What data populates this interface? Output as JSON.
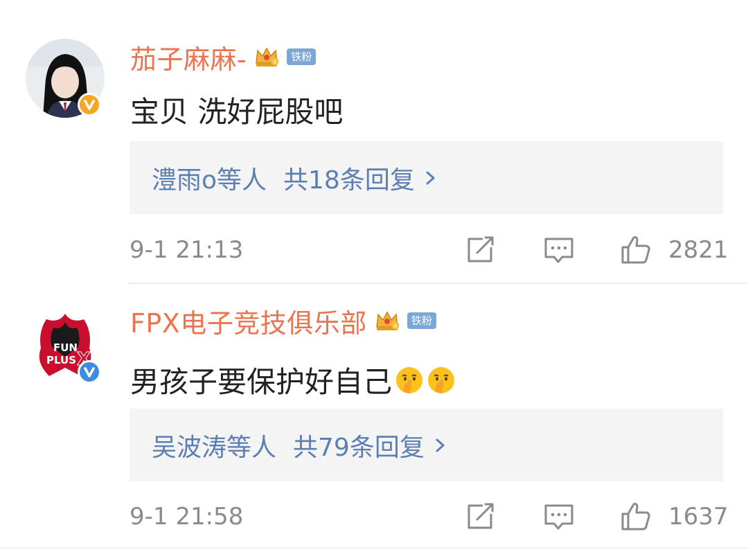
{
  "comments": [
    {
      "username": "茄子麻麻-",
      "badge": "铁粉",
      "text": "宝贝 洗好屁股吧",
      "reply_users": "澧雨o等人",
      "reply_count": "共18条回复",
      "time": "9-1 21:13",
      "likes": "2821",
      "avatar_icon": "girl-portrait-avatar",
      "verify_color": "#f5a623"
    },
    {
      "username": "FPX电子竞技俱乐部",
      "badge": "铁粉",
      "text": "男孩子要保护好自己",
      "reply_users": "吴波涛等人",
      "reply_count": "共79条回复",
      "time": "9-1 21:58",
      "likes": "1637",
      "avatar_icon": "funplus-phoenix-logo",
      "verify_color": "#3d8ce0"
    }
  ],
  "colors": {
    "username": "#eb7350",
    "link": "#5b7fb3",
    "meta": "#8a8a8a",
    "badge_bg": "#7aa7d8",
    "reply_bg": "#f4f4f4"
  },
  "icons": {
    "crown": "crown-icon",
    "share": "share-icon",
    "reply": "comment-icon",
    "like": "thumbs-up-icon",
    "emoji": "shushing-face-emoji",
    "chevron": "chevron-right-icon"
  }
}
